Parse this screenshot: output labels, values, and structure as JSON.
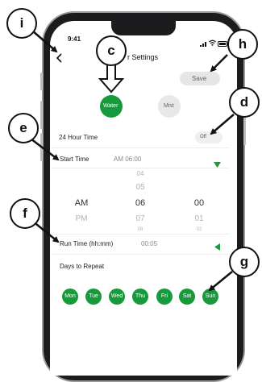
{
  "status_bar": {
    "time": "9:41",
    "icons": [
      "signal-icon",
      "wifi-icon",
      "battery-icon"
    ]
  },
  "header": {
    "title": "r Settings",
    "back_icon": "chevron-left-icon",
    "save_label": "Save"
  },
  "mode": {
    "water_label": "Water",
    "mist_label": "Mist",
    "selected": "Water"
  },
  "hour24": {
    "label": "24 Hour Time",
    "toggle_label": "Off"
  },
  "start_time": {
    "label": "Start Time",
    "value": "AM 06:00"
  },
  "picker": {
    "col1": [
      "AM",
      "PM"
    ],
    "col2": [
      "04",
      "05",
      "06",
      "07",
      "08"
    ],
    "col3": [
      "00",
      "01",
      "02"
    ]
  },
  "run_time": {
    "label": "Run Time (hh:mm)",
    "value": "00:05"
  },
  "days": {
    "label": "Days to Repeat",
    "items": [
      "Mon",
      "Tue",
      "Wed",
      "Thu",
      "Fri",
      "Sat",
      "Sun"
    ]
  },
  "callouts": {
    "i": "i",
    "c": "c",
    "h": "h",
    "d": "d",
    "e": "e",
    "f": "f",
    "g": "g"
  },
  "colors": {
    "accent": "#179a3c",
    "arrow_green": "#1a9b35"
  }
}
